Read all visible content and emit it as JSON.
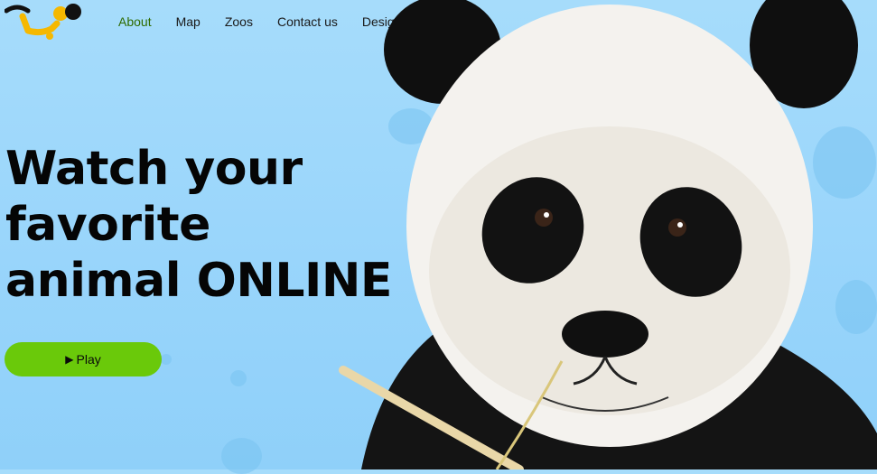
{
  "nav": {
    "items": [
      {
        "label": "About",
        "active": true
      },
      {
        "label": "Map",
        "active": false
      },
      {
        "label": "Zoos",
        "active": false
      },
      {
        "label": "Contact us",
        "active": false
      },
      {
        "label": "Design",
        "active": false
      }
    ]
  },
  "hero": {
    "headline_lines": [
      "Watch your",
      "favorite",
      "animal ONLINE"
    ],
    "play_label": "Play",
    "play_icon": "play-icon"
  },
  "colors": {
    "background": "#9dd8fa",
    "accent_green": "#6ac90a",
    "active_nav": "#2f6b00",
    "logo_yellow": "#f5b800",
    "logo_black": "#111111"
  },
  "image": {
    "subject": "panda-photo"
  }
}
